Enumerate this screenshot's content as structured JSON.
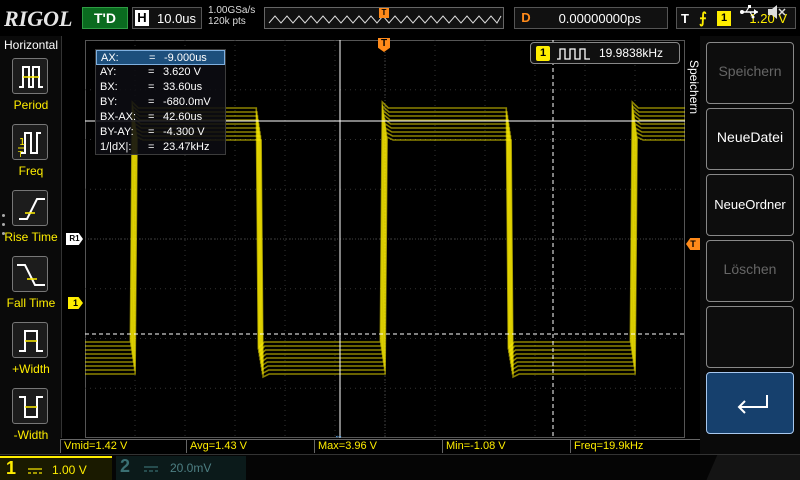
{
  "brand": {
    "logo": "RIGOL"
  },
  "topbar": {
    "trigger_status": "T'D",
    "horizontal": {
      "tag": "H",
      "timebase": "10.0us"
    },
    "acquisition": {
      "sample_rate": "1.00GSa/s",
      "memory_depth": "120k pts"
    },
    "memory_marker": "T",
    "delay": {
      "tag": "D",
      "value": "0.00000000ps"
    },
    "trigger": {
      "tag": "T",
      "source": "1",
      "level": "1.20 V"
    }
  },
  "left_menu": {
    "title": "Horizontal",
    "items": [
      {
        "label": "Period",
        "icon": "period-icon"
      },
      {
        "label": "Freq",
        "icon": "freq-icon"
      },
      {
        "label": "Rise Time",
        "icon": "rise-time-icon"
      },
      {
        "label": "Fall Time",
        "icon": "fall-time-icon"
      },
      {
        "label": "+Width",
        "icon": "positive-width-icon"
      },
      {
        "label": "-Width",
        "icon": "negative-width-icon"
      }
    ]
  },
  "cursor_panel": {
    "rows": [
      {
        "key": "AX:",
        "value": "-9.000us"
      },
      {
        "key": "AY:",
        "value": "3.620 V"
      },
      {
        "key": "BX:",
        "value": "33.60us"
      },
      {
        "key": "BY:",
        "value": "-680.0mV"
      },
      {
        "key": "BX-AX:",
        "value": "42.60us"
      },
      {
        "key": "BY-AY:",
        "value": "-4.300 V"
      },
      {
        "key": "1/|dX|:",
        "value": "23.47kHz"
      }
    ],
    "eq": "="
  },
  "freq_counter": {
    "channel": "1",
    "value": "19.9838kHz"
  },
  "markers": {
    "trigger_pos": "T",
    "trigger_level": "T",
    "ch1_offset": "1",
    "reference": "R1",
    "cursor_bottom": "↔"
  },
  "measurements": [
    {
      "label": "Vmid=1.42 V"
    },
    {
      "label": "Avg=1.43 V"
    },
    {
      "label": "Max=3.96 V"
    },
    {
      "label": "Min=-1.08 V"
    },
    {
      "label": "Freq=19.9kHz"
    }
  ],
  "channels": {
    "ch1": {
      "number": "1",
      "scale": "1.00 V",
      "color": "#ffee00"
    },
    "ch2": {
      "number": "2",
      "scale": "20.0mV",
      "color": "#3a6f73"
    }
  },
  "right_menu": {
    "title": "Speichern",
    "buttons": [
      {
        "label": "Speichern",
        "enabled": false
      },
      {
        "label": "NeueDatei",
        "enabled": true
      },
      {
        "label": "NeueOrdner",
        "enabled": true
      },
      {
        "label": "Löschen",
        "enabled": false
      },
      {
        "label": "",
        "enabled": false
      },
      {
        "label": "back-icon",
        "enabled": true
      }
    ]
  },
  "status_icons": [
    "usb-icon",
    "speaker-muted-icon"
  ]
}
